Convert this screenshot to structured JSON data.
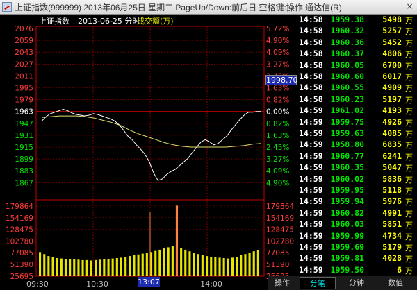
{
  "window": {
    "title": "上证指数(999999) 2013年06月25日 星期二 PageUp/Down:前后日 空格键:操作 通达信(R)",
    "close_label": "×"
  },
  "chart_header": {
    "name": "上证指数",
    "date_label": "2013-06-25 分时",
    "volume_label": "成交额(万)"
  },
  "colors": {
    "up": "#ff3b3b",
    "down": "#00e600",
    "flat": "#ffffff",
    "price_line": "#ffffff",
    "avg_line": "#e0e070",
    "volume_bar": "#e6e600",
    "grid": "#a00000",
    "frame": "#c00000"
  },
  "chart_data": {
    "type": "line",
    "prev_close": 1963,
    "price_axis_left": [
      "2076",
      "2059",
      "2043",
      "2027",
      "2011",
      "1995",
      "1979",
      "1963",
      "1947",
      "1931",
      "1915",
      "1899",
      "1883",
      "1867"
    ],
    "pct_axis_right": [
      "5.72%",
      "4.90%",
      "4.09%",
      "3.27%",
      "2.45%",
      "1.63%",
      "0.82%",
      "0.00%",
      "0.82%",
      "1.63%",
      "2.45%",
      "3.27%",
      "4.09%",
      "4.90%"
    ],
    "volume_axis": [
      "179864",
      "154169",
      "128475",
      "102780",
      "77085",
      "51390",
      "25695"
    ],
    "time_axis": [
      "09:30",
      "10:30",
      "13:07",
      "14:00"
    ],
    "ylim": [
      1867,
      2076
    ],
    "price_series": [
      1950,
      1956,
      1960,
      1962,
      1964,
      1966,
      1964,
      1961,
      1959,
      1958,
      1957,
      1958,
      1960,
      1959,
      1957,
      1955,
      1953,
      1950,
      1945,
      1938,
      1930,
      1925,
      1918,
      1912,
      1905,
      1895,
      1880,
      1870,
      1872,
      1878,
      1882,
      1885,
      1890,
      1895,
      1900,
      1908,
      1915,
      1922,
      1925,
      1922,
      1918,
      1920,
      1925,
      1930,
      1938,
      1945,
      1952,
      1958,
      1962,
      1962,
      1963,
      1963
    ],
    "avg_series": [
      1955,
      1956,
      1957,
      1957,
      1957,
      1956,
      1954,
      1951,
      1948,
      1944,
      1938,
      1933,
      1929,
      1925,
      1921,
      1918,
      1916,
      1915,
      1915,
      1915,
      1915,
      1915,
      1916,
      1917,
      1919,
      1920
    ],
    "volume_series": [
      60000,
      55000,
      50000,
      48000,
      45000,
      44000,
      43000,
      42000,
      42000,
      41000,
      40000,
      40000,
      39000,
      40000,
      41000,
      42000,
      43000,
      44000,
      45000,
      46000,
      48000,
      50000,
      52000,
      54000,
      56000,
      58000,
      60000,
      63000,
      66000,
      70000,
      72000,
      75000,
      176000,
      70000,
      66000,
      62000,
      58000,
      55000,
      52000,
      50000,
      48000,
      47000,
      46000,
      45000,
      44000,
      46000,
      48000,
      52000,
      55000,
      58000,
      62000,
      64000
    ],
    "cursor_price": "1998.70",
    "cursor_time": "13:07"
  },
  "ticks": [
    {
      "time": "14:58",
      "price": "1959.38",
      "vol": "5498"
    },
    {
      "time": "14:58",
      "price": "1960.32",
      "vol": "5257"
    },
    {
      "time": "14:58",
      "price": "1960.36",
      "vol": "5452"
    },
    {
      "time": "14:58",
      "price": "1960.37",
      "vol": "4806"
    },
    {
      "time": "14:58",
      "price": "1960.05",
      "vol": "6700"
    },
    {
      "time": "14:58",
      "price": "1960.60",
      "vol": "6017"
    },
    {
      "time": "14:58",
      "price": "1960.55",
      "vol": "4909"
    },
    {
      "time": "14:58",
      "price": "1960.23",
      "vol": "5197"
    },
    {
      "time": "14:59",
      "price": "1961.02",
      "vol": "4193"
    },
    {
      "time": "14:59",
      "price": "1959.75",
      "vol": "4926"
    },
    {
      "time": "14:59",
      "price": "1959.63",
      "vol": "4085"
    },
    {
      "time": "14:59",
      "price": "1958.80",
      "vol": "6835"
    },
    {
      "time": "14:59",
      "price": "1960.77",
      "vol": "6241"
    },
    {
      "time": "14:59",
      "price": "1960.35",
      "vol": "5047"
    },
    {
      "time": "14:59",
      "price": "1960.02",
      "vol": "5836"
    },
    {
      "time": "14:59",
      "price": "1959.95",
      "vol": "5118"
    },
    {
      "time": "14:59",
      "price": "1959.94",
      "vol": "5976"
    },
    {
      "time": "14:59",
      "price": "1960.82",
      "vol": "4991"
    },
    {
      "time": "14:59",
      "price": "1960.03",
      "vol": "5851"
    },
    {
      "time": "14:59",
      "price": "1959.99",
      "vol": "4734"
    },
    {
      "time": "14:59",
      "price": "1959.69",
      "vol": "5179"
    },
    {
      "time": "14:59",
      "price": "1959.81",
      "vol": "4028"
    },
    {
      "time": "14:59",
      "price": "1959.50",
      "vol": "6"
    }
  ],
  "unit": "万",
  "tabs": [
    "操作",
    "分笔",
    "分钟",
    "数值"
  ],
  "active_tab": 1
}
